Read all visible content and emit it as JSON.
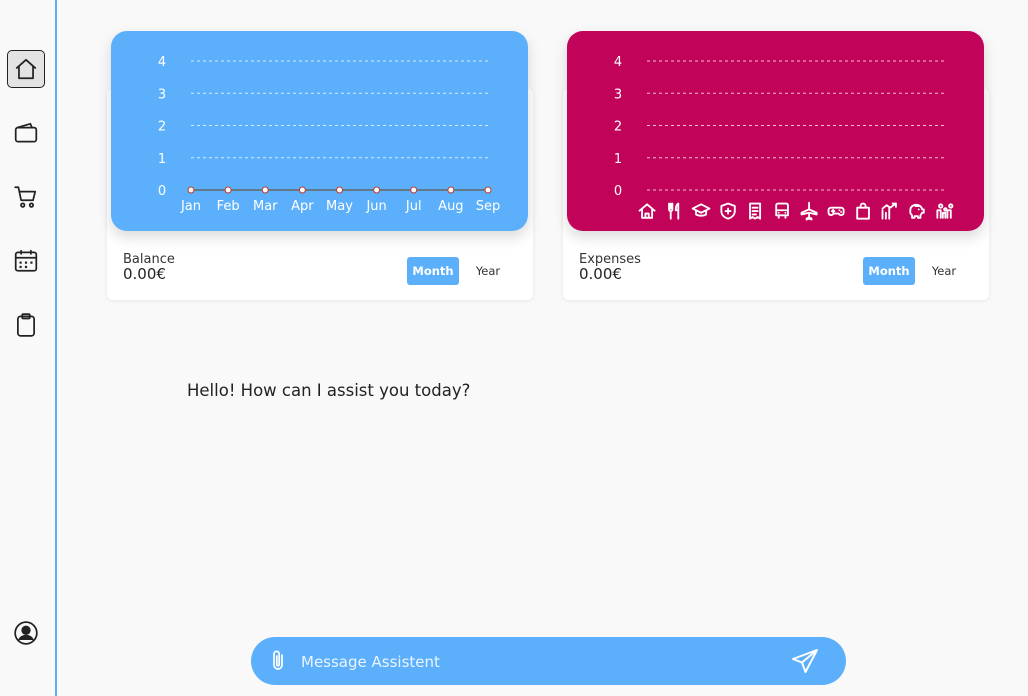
{
  "sidebar": {
    "items": [
      {
        "name": "home",
        "icon": "home-icon",
        "active": true
      },
      {
        "name": "wallet",
        "icon": "wallet-icon",
        "active": false
      },
      {
        "name": "cart",
        "icon": "cart-icon",
        "active": false
      },
      {
        "name": "calendar",
        "icon": "calendar-icon",
        "active": false
      },
      {
        "name": "clipboard",
        "icon": "clipboard-icon",
        "active": false
      }
    ],
    "profile_icon": "user-circle-icon"
  },
  "balance_card": {
    "label": "Balance",
    "value": "0.00€",
    "toggle_month": "Month",
    "toggle_year": "Year",
    "color": "#5cb0fb"
  },
  "expenses_card": {
    "label": "Expenses",
    "value": "0.00€",
    "toggle_month": "Month",
    "toggle_year": "Year",
    "color": "#c2035a",
    "category_icons": [
      "home-icon",
      "restaurant-icon",
      "education-icon",
      "health-icon",
      "bills-icon",
      "transport-icon",
      "travel-icon",
      "gaming-icon",
      "shopping-icon",
      "investments-icon",
      "savings-icon",
      "family-icon"
    ]
  },
  "chart_data": [
    {
      "type": "line",
      "categories": [
        "Jan",
        "Feb",
        "Mar",
        "Apr",
        "May",
        "Jun",
        "Jul",
        "Aug",
        "Sep"
      ],
      "y_ticks": [
        "0",
        "1",
        "2",
        "3",
        "4"
      ],
      "values": [
        0,
        0,
        0,
        0,
        0,
        0,
        0,
        0,
        0
      ],
      "ylim": [
        0,
        4
      ],
      "grid": true
    },
    {
      "type": "bar",
      "y_ticks": [
        "0",
        "1",
        "2",
        "3",
        "4"
      ],
      "values": [
        0,
        0,
        0,
        0,
        0,
        0,
        0,
        0,
        0,
        0,
        0,
        0
      ],
      "ylim": [
        0,
        4
      ],
      "grid": true
    }
  ],
  "chat": {
    "greeting": "Hello! How can I assist you today?",
    "input_placeholder": "Message Assistent",
    "input_value": ""
  }
}
